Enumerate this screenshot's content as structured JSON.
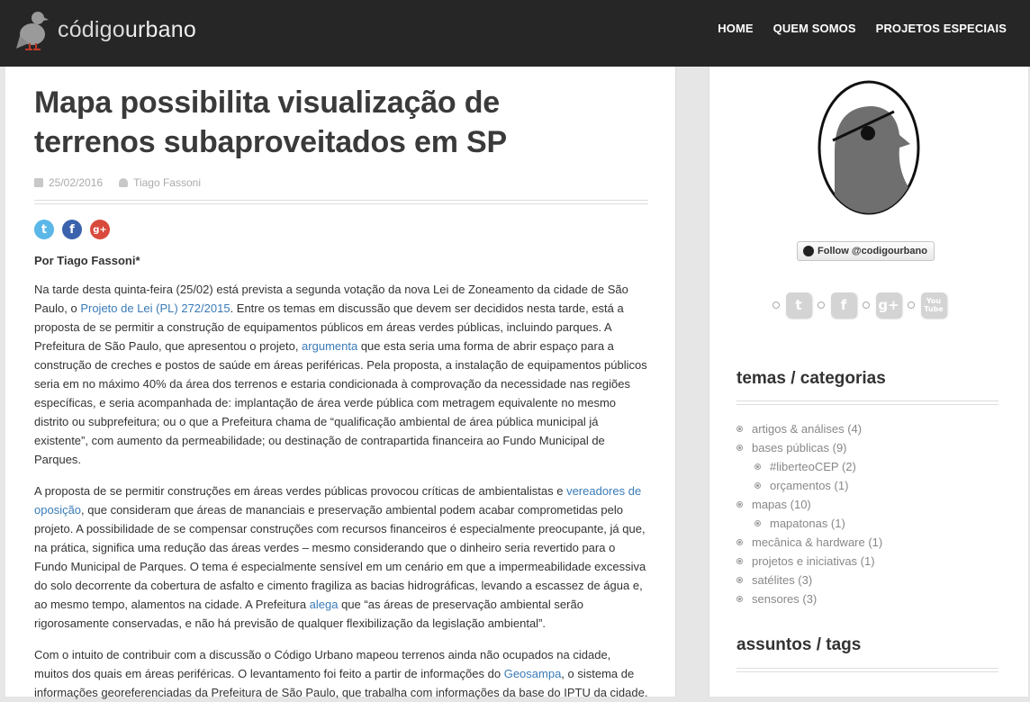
{
  "header": {
    "logo_part1": "código",
    "logo_part2": "urbano",
    "nav": [
      "HOME",
      "QUEM SOMOS",
      "PROJETOS ESPECIAIS"
    ]
  },
  "article": {
    "title_line1": "Mapa possibilita visualização de",
    "title_line2": "terrenos subaproveitados em SP",
    "date": "25/02/2016",
    "author": "Tiago Fassoni",
    "byline": "Por Tiago Fassoni*",
    "p1": {
      "t1": "Na tarde desta quinta-feira (25/02) está prevista a segunda votação da nova Lei de Zoneamento da cidade de São Paulo, o ",
      "link1": "Projeto de Lei (PL) 272/2015",
      "t2": ". Entre os temas em discussão que devem ser decididos nesta tarde, está a proposta de se permitir a construção de equipamentos públicos em áreas verdes públicas, incluindo parques. A Prefeitura de São Paulo, que apresentou o projeto, ",
      "link2": "argumenta",
      "t3": " que esta seria uma forma de abrir espaço para a construção de creches e postos de saúde em áreas periféricas. Pela proposta, a instalação de equipamentos públicos seria em no máximo 40% da área dos terrenos e estaria condicionada à comprovação da necessidade nas regiões específicas, e seria acompanhada de: implantação de área verde pública com metragem equivalente no mesmo distrito ou subprefeitura; ou o que a Prefeitura chama de “qualificação ambiental de área pública municipal já existente”, com aumento da permeabilidade; ou destinação de contrapartida financeira ao Fundo Municipal de Parques."
    },
    "p2": {
      "t1": "A proposta de se permitir construções em áreas verdes públicas provocou críticas de ambientalistas e ",
      "link1": "vereadores de oposição",
      "t2": ", que consideram que áreas de mananciais e preservação ambiental podem acabar comprometidas pelo projeto. A possibilidade de se compensar construções com recursos financeiros é especialmente preocupante, já que, na prática, significa uma redução das áreas verdes – mesmo considerando que o dinheiro seria revertido para o Fundo Municipal de Parques. O tema é especialmente sensível em um cenário em que a impermeabilidade excessiva do solo decorrente da cobertura de asfalto e cimento fragiliza as bacias hidrográficas, levando a escassez de água e, ao mesmo tempo, alamentos na cidade. A Prefeitura ",
      "link2": "alega",
      "t3": " que “as áreas de preservação ambiental serão rigorosamente conservadas, e não há previsão de qualquer flexibilização da legislação ambiental”."
    },
    "p3": {
      "t1": "Com o intuito de contribuir com a discussão o Código Urbano mapeou terrenos ainda não ocupados na cidade, muitos dos quais em áreas periféricas. O levantamento foi feito a partir de informações do ",
      "link1": "Geosampa",
      "t2": ", o sistema de informações georeferenciadas da Prefeitura de São Paulo, que trabalha com informações da base do IPTU da cidade."
    }
  },
  "sidebar": {
    "follow_label": "Follow @codigourbano",
    "social_icons": [
      "twitter-icon",
      "facebook-icon",
      "google-plus-icon",
      "youtube-icon"
    ],
    "widget1_title": "temas / categorias",
    "categories": [
      {
        "label": "artigos & análises (4)",
        "level": 0
      },
      {
        "label": "bases públicas (9)",
        "level": 0
      },
      {
        "label": "#liberteoCEP (2)",
        "level": 1
      },
      {
        "label": "orçamentos (1)",
        "level": 1
      },
      {
        "label": "mapas (10)",
        "level": 0
      },
      {
        "label": "mapatonas (1)",
        "level": 1
      },
      {
        "label": "mecânica & hardware (1)",
        "level": 0
      },
      {
        "label": "projetos e iniciativas (1)",
        "level": 0
      },
      {
        "label": "satélites (3)",
        "level": 0
      },
      {
        "label": "sensores (3)",
        "level": 0
      }
    ],
    "widget2_title": "assuntos / tags"
  }
}
